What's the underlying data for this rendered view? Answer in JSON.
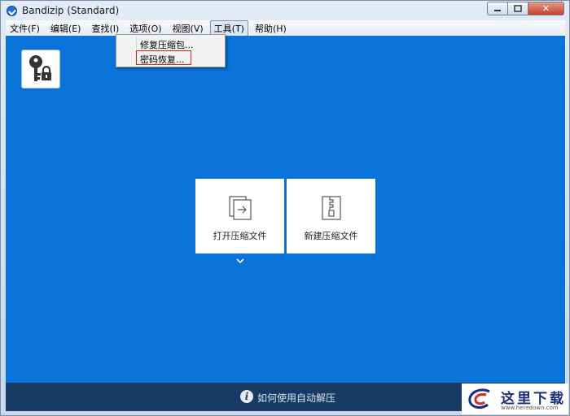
{
  "window": {
    "title": "Bandizip (Standard)",
    "controls": {
      "minimize": "▭",
      "maximize": "▢",
      "close": "✕"
    }
  },
  "menubar": {
    "items": [
      {
        "label": "文件(F)"
      },
      {
        "label": "编辑(E)"
      },
      {
        "label": "查找(I)"
      },
      {
        "label": "选项(O)"
      },
      {
        "label": "视图(V)"
      },
      {
        "label": "工具(T)",
        "active": true
      },
      {
        "label": "帮助(H)"
      }
    ]
  },
  "tools_menu": {
    "items": [
      {
        "label": "修复压缩包..."
      },
      {
        "label": "密码恢复...",
        "highlighted": true
      }
    ]
  },
  "main": {
    "tool_icon": "key-lock-icon",
    "cards": [
      {
        "label": "打开压缩文件",
        "icon": "open-archive-icon"
      },
      {
        "label": "新建压缩文件",
        "icon": "new-archive-icon"
      }
    ],
    "expand_icon": "chevron-down-icon"
  },
  "bottom": {
    "text": "如何使用自动解压",
    "icon": "info-icon"
  },
  "watermark": {
    "text": "这里下载",
    "url": "www.heredown.com"
  },
  "colors": {
    "main_bg": "#0a73d9",
    "bottom_bg": "#163a64",
    "highlight": "#d0241b"
  }
}
